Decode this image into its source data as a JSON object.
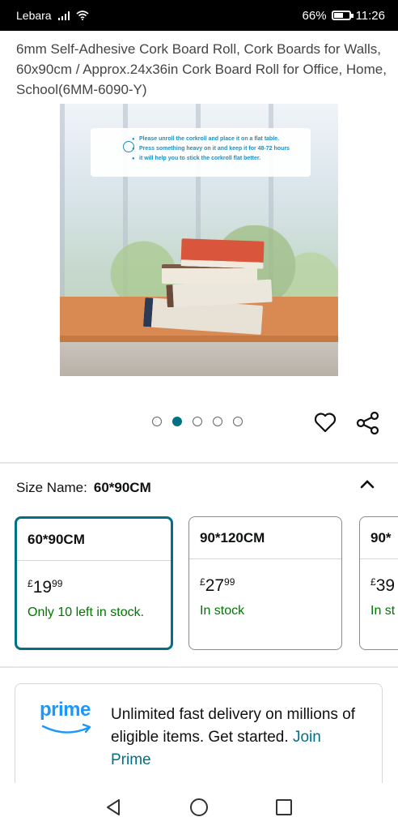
{
  "status": {
    "carrier": "Lebara",
    "battery": "66%",
    "battery_level": 0.66,
    "time": "11:26"
  },
  "product": {
    "title": "6mm Self-Adhesive Cork Board Roll, Cork Boards for Walls, 60x90cm / Approx.24x36in Cork Board Roll for Office, Home, School(6MM-6090-Y)",
    "image_note": [
      "Please unroll the corkroll and place it on a flat table.",
      "Press something heavy on it and keep it for 48-72 hours",
      "it will help you to stick the corkroll flat better."
    ],
    "image_count": 5,
    "active_image": 1
  },
  "size": {
    "label": "Size Name:",
    "selected": "60*90CM",
    "options": [
      {
        "name": "60*90CM",
        "currency": "£",
        "whole": "19",
        "fraction": "99",
        "stock": "Only 10 left in stock."
      },
      {
        "name": "90*120CM",
        "currency": "£",
        "whole": "27",
        "fraction": "99",
        "stock": "In stock"
      },
      {
        "name": "90*",
        "currency": "£",
        "whole": "39",
        "fraction": "",
        "stock": "In st"
      }
    ]
  },
  "prime": {
    "logo": "prime",
    "text": "Unlimited fast delivery on millions of eligible items. Get started.",
    "link": "Join Prime"
  },
  "colors": {
    "accent": "#007185",
    "stock_green": "#007600",
    "prime_blue": "#1a98ff"
  }
}
